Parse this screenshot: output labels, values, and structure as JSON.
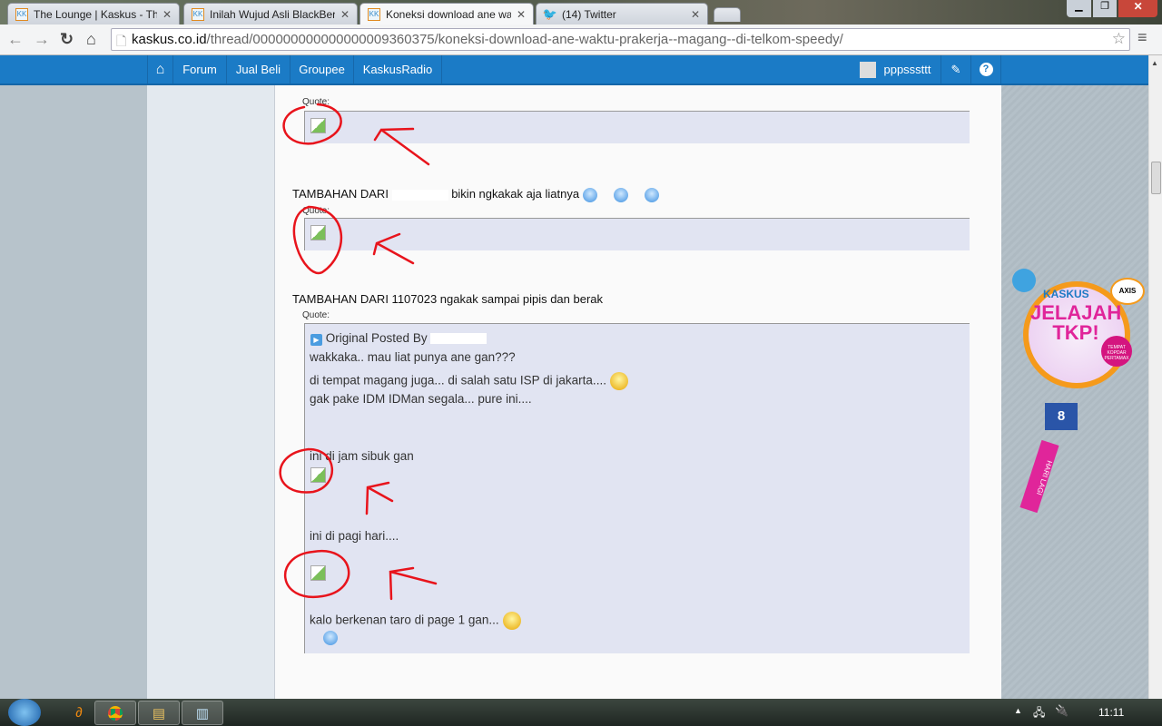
{
  "browser": {
    "tabs": [
      {
        "title": "The Lounge | Kaskus - The",
        "active": false,
        "icon": "kaskus-icon"
      },
      {
        "title": "Inilah Wujud Asli BlackBer",
        "active": false,
        "icon": "kaskus-icon"
      },
      {
        "title": "Koneksi download ane wa",
        "active": true,
        "icon": "kaskus-icon"
      },
      {
        "title": "(14) Twitter",
        "active": false,
        "icon": "twitter-icon"
      }
    ],
    "url_domain": "kaskus.co.id",
    "url_path": "/thread/000000000000000009360375/koneksi-download-ane-waktu-prakerja--magang--di-telkom-speedy/"
  },
  "nav": {
    "items": [
      "Forum",
      "Jual Beli",
      "Groupee",
      "KaskusRadio"
    ],
    "username": "pppsssttt",
    "color": "#1b7bc6"
  },
  "post": {
    "quote_label": "Quote:",
    "line1_prefix": "TAMBAHAN DARI",
    "line1_suffix": "bikin ngkakak aja liatnya",
    "line2": "TAMBAHAN DARI 1107023 ngakak sampai pipis dan berak",
    "original_posted_by": "Original Posted By",
    "quote_lines": [
      "wakkaka.. mau liat punya ane gan???",
      "di tempat magang juga... di salah satu ISP di jakarta....",
      "gak pake IDM IDMan segala... pure ini....",
      "ini di jam sibuk gan",
      "ini di pagi hari....",
      "kalo berkenan taro di page 1 gan..."
    ]
  },
  "banner": {
    "brand": "KASKUS",
    "partner": "AXIS",
    "title": "JELAJAH TKP!",
    "badge": "TEMPAT KOPDAR PERTAMAX",
    "days": "8",
    "ribbon": "HARI LAGI"
  },
  "taskbar": {
    "clock": "11:11"
  },
  "annotation_color": "#e8141c"
}
